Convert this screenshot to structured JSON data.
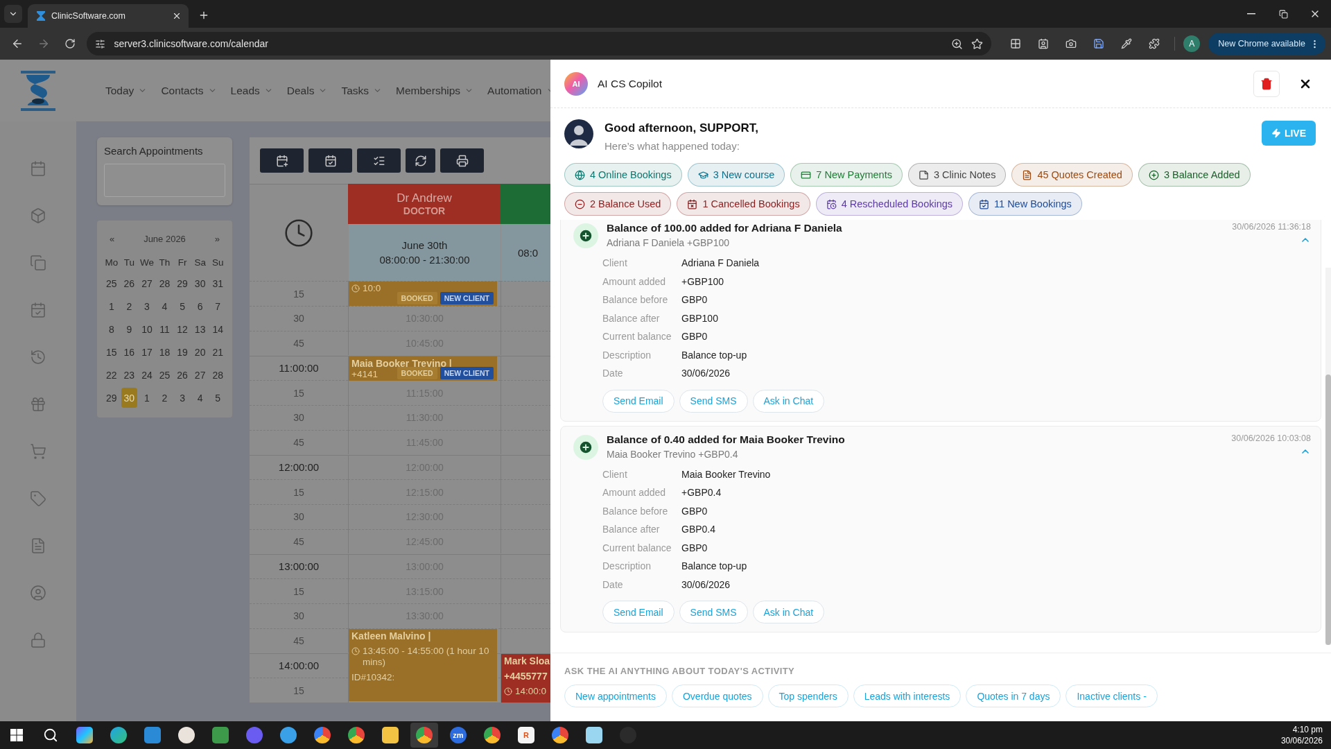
{
  "browser": {
    "tab_title": "ClinicSoftware.com",
    "url": "server3.clinicsoftware.com/calendar",
    "profile_initial": "A",
    "update_button": "New Chrome available"
  },
  "app": {
    "nav": [
      "Today",
      "Contacts",
      "Leads",
      "Deals",
      "Tasks",
      "Memberships",
      "Automation"
    ],
    "search": {
      "title": "Search Appointments"
    },
    "calendar": {
      "prev": "«",
      "month": "June 2026",
      "next": "»",
      "weekdays": [
        "Mo",
        "Tu",
        "We",
        "Th",
        "Fr",
        "Sa",
        "Su"
      ],
      "weeks": [
        [
          {
            "day": "25",
            "selected": false
          },
          {
            "day": "26",
            "selected": false
          },
          {
            "day": "27",
            "selected": false
          },
          {
            "day": "28",
            "selected": false
          },
          {
            "day": "29",
            "selected": false
          },
          {
            "day": "30",
            "selected": false
          },
          {
            "day": "31",
            "selected": false
          }
        ],
        [
          {
            "day": "1",
            "selected": false
          },
          {
            "day": "2",
            "selected": false
          },
          {
            "day": "3",
            "selected": false
          },
          {
            "day": "4",
            "selected": false
          },
          {
            "day": "5",
            "selected": false
          },
          {
            "day": "6",
            "selected": false
          },
          {
            "day": "7",
            "selected": false
          }
        ],
        [
          {
            "day": "8",
            "selected": false
          },
          {
            "day": "9",
            "selected": false
          },
          {
            "day": "10",
            "selected": false
          },
          {
            "day": "11",
            "selected": false
          },
          {
            "day": "12",
            "selected": false
          },
          {
            "day": "13",
            "selected": false
          },
          {
            "day": "14",
            "selected": false
          }
        ],
        [
          {
            "day": "15",
            "selected": false
          },
          {
            "day": "16",
            "selected": false
          },
          {
            "day": "17",
            "selected": false
          },
          {
            "day": "18",
            "selected": false
          },
          {
            "day": "19",
            "selected": false
          },
          {
            "day": "20",
            "selected": false
          },
          {
            "day": "21",
            "selected": false
          }
        ],
        [
          {
            "day": "22",
            "selected": false
          },
          {
            "day": "23",
            "selected": false
          },
          {
            "day": "24",
            "selected": false
          },
          {
            "day": "25",
            "selected": false
          },
          {
            "day": "26",
            "selected": false
          },
          {
            "day": "27",
            "selected": false
          },
          {
            "day": "28",
            "selected": false
          }
        ],
        [
          {
            "day": "29",
            "selected": false
          },
          {
            "day": "30",
            "selected": true
          },
          {
            "day": "1",
            "selected": false
          },
          {
            "day": "2",
            "selected": false
          },
          {
            "day": "3",
            "selected": false
          },
          {
            "day": "4",
            "selected": false
          },
          {
            "day": "5",
            "selected": false
          }
        ]
      ]
    },
    "schedule": {
      "doctor": {
        "name": "Dr Andrew",
        "role": "DOCTOR",
        "date": "June 30th",
        "hours": "08:00:00 - 21:30:00"
      },
      "second_column": {
        "hours": "08:0"
      },
      "rows": [
        {
          "label": "15",
          "major": false,
          "appointment": {
            "kind": "short",
            "color": "#9a6f28",
            "lines": [
              {
                "kind": "time",
                "text": "10:0"
              }
            ],
            "badges": [
              {
                "kind": "booked",
                "text": "BOOKED"
              },
              {
                "kind": "new",
                "text": "NEW CLIENT"
              }
            ]
          }
        },
        {
          "label": "30",
          "major": false,
          "slot": "10:30:00"
        },
        {
          "label": "45",
          "major": false,
          "slot": "10:45:00"
        },
        {
          "label": "11:00:00",
          "major": true,
          "appointment": {
            "kind": "short",
            "color": "#9a6f28",
            "lines": [
              {
                "kind": "name",
                "text": "Maia Booker Trevino |"
              },
              {
                "kind": "text",
                "text": "+4141"
              }
            ],
            "badges": [
              {
                "kind": "booked",
                "text": "BOOKED"
              },
              {
                "kind": "new",
                "text": "NEW CLIENT"
              }
            ]
          }
        },
        {
          "label": "15",
          "major": false,
          "slot": "11:15:00"
        },
        {
          "label": "30",
          "major": false,
          "slot": "11:30:00"
        },
        {
          "label": "45",
          "major": false,
          "slot": "11:45:00"
        },
        {
          "label": "12:00:00",
          "major": true,
          "slot": "12:00:00"
        },
        {
          "label": "15",
          "major": false,
          "slot": "12:15:00"
        },
        {
          "label": "30",
          "major": false,
          "slot": "12:30:00"
        },
        {
          "label": "45",
          "major": false,
          "slot": "12:45:00"
        },
        {
          "label": "13:00:00",
          "major": true,
          "slot": "13:00:00"
        },
        {
          "label": "15",
          "major": false,
          "slot": "13:15:00"
        },
        {
          "label": "30",
          "major": false,
          "slot": "13:30:00"
        },
        {
          "label": "45",
          "major": false,
          "appointment": {
            "kind": "long",
            "color": "#9a6f28",
            "lines": [
              {
                "kind": "name",
                "text": "Katleen Malvino |"
              },
              {
                "kind": "time",
                "text": "13:45:00 - 14:55:00 (1 hour 10 mins)"
              },
              {
                "kind": "text",
                "text": "ID#10342:"
              }
            ]
          }
        },
        {
          "label": "14:00:00",
          "major": true,
          "second_appointment": {
            "kind": "long",
            "color": "#9e2d24",
            "lines": [
              {
                "kind": "name",
                "text": "Mark Sloa"
              },
              {
                "kind": "name",
                "text": "+4455777"
              },
              {
                "kind": "time",
                "text": "14:00:0"
              }
            ]
          }
        },
        {
          "label": "15",
          "major": false
        }
      ]
    }
  },
  "copilot": {
    "logo_text": "AI",
    "title": "AI CS Copilot",
    "greeting": "Good afternoon, SUPPORT,",
    "subtitle": "Here’s what happened today:",
    "live_button": "LIVE",
    "chip_rows": [
      [
        {
          "kind": "globe",
          "text": "4 Online Bookings",
          "color": "#0f766e"
        },
        {
          "kind": "course",
          "text": "3 New course",
          "color": "#0e6f8a"
        },
        {
          "kind": "payment",
          "text": "7 New Payments",
          "color": "#1f7a36"
        },
        {
          "kind": "note",
          "text": "3 Clinic Notes",
          "color": "#444444"
        },
        {
          "kind": "quote",
          "text": "45 Quotes Created",
          "color": "#9a4a12"
        },
        {
          "kind": "plus",
          "text": "3 Balance Added",
          "color": "#1b5e2a"
        }
      ],
      [
        {
          "kind": "minus",
          "text": "2 Balance Used",
          "color": "#8b1d1d"
        },
        {
          "kind": "cancel",
          "text": "1 Cancelled Bookings",
          "color": "#8b1d1d"
        },
        {
          "kind": "reschedule",
          "text": "4 Rescheduled Bookings",
          "color": "#5b3aa8"
        },
        {
          "kind": "booking",
          "text": "11 New Bookings",
          "color": "#1e4a9a"
        }
      ]
    ],
    "events": [
      {
        "title": "Balance of 100.00 added for Adriana F Daniela",
        "subtitle": "Adriana F Daniela +GBP100",
        "timestamp": "30/06/2026 11:36:18",
        "expanded": true,
        "fields": [
          {
            "label": "Client",
            "value": "Adriana F Daniela"
          },
          {
            "label": "Amount added",
            "value": "+GBP100"
          },
          {
            "label": "Balance before",
            "value": "GBP0"
          },
          {
            "label": "Balance after",
            "value": "GBP100"
          },
          {
            "label": "Current balance",
            "value": "GBP0"
          },
          {
            "label": "Description",
            "value": "Balance top-up"
          },
          {
            "label": "Date",
            "value": "30/06/2026"
          }
        ],
        "actions": [
          "Send Email",
          "Send SMS",
          "Ask in Chat"
        ]
      },
      {
        "title": "Balance of 0.40 added for Maia Booker Trevino",
        "subtitle": "Maia Booker Trevino +GBP0.4",
        "timestamp": "30/06/2026 10:03:08",
        "expanded": true,
        "fields": [
          {
            "label": "Client",
            "value": "Maia Booker Trevino"
          },
          {
            "label": "Amount added",
            "value": "+GBP0.4"
          },
          {
            "label": "Balance before",
            "value": "GBP0"
          },
          {
            "label": "Balance after",
            "value": "GBP0.4"
          },
          {
            "label": "Current balance",
            "value": "GBP0"
          },
          {
            "label": "Description",
            "value": "Balance top-up"
          },
          {
            "label": "Date",
            "value": "30/06/2026"
          }
        ],
        "actions": [
          "Send Email",
          "Send SMS",
          "Ask in Chat"
        ]
      }
    ],
    "ask_label": "ASK THE AI ANYTHING ABOUT TODAY'S ACTIVITY",
    "suggestions": [
      "New appointments",
      "Overdue quotes",
      "Top spenders",
      "Leads with interests",
      "Quotes in 7 days",
      "Inactive clients -"
    ]
  },
  "taskbar": {
    "apps": [
      {
        "kind": "copilot",
        "selected": false
      },
      {
        "kind": "edge",
        "selected": false
      },
      {
        "kind": "triangle",
        "selected": false
      },
      {
        "kind": "cloud",
        "selected": false
      },
      {
        "kind": "sheet",
        "selected": false
      },
      {
        "kind": "chat",
        "selected": false
      },
      {
        "kind": "bird",
        "selected": false
      },
      {
        "kind": "browser",
        "selected": false
      },
      {
        "kind": "chrome",
        "selected": false
      },
      {
        "kind": "folder",
        "selected": false
      },
      {
        "kind": "chrome",
        "selected": true
      },
      {
        "kind": "tile",
        "label": "zm",
        "selected": false
      },
      {
        "kind": "chrome",
        "selected": false
      },
      {
        "kind": "letter",
        "label": "R",
        "selected": false
      },
      {
        "kind": "browser",
        "selected": false
      },
      {
        "kind": "notes",
        "selected": false
      },
      {
        "kind": "clock",
        "selected": false
      }
    ],
    "time": "4:10 pm",
    "date": "30/06/2026"
  }
}
